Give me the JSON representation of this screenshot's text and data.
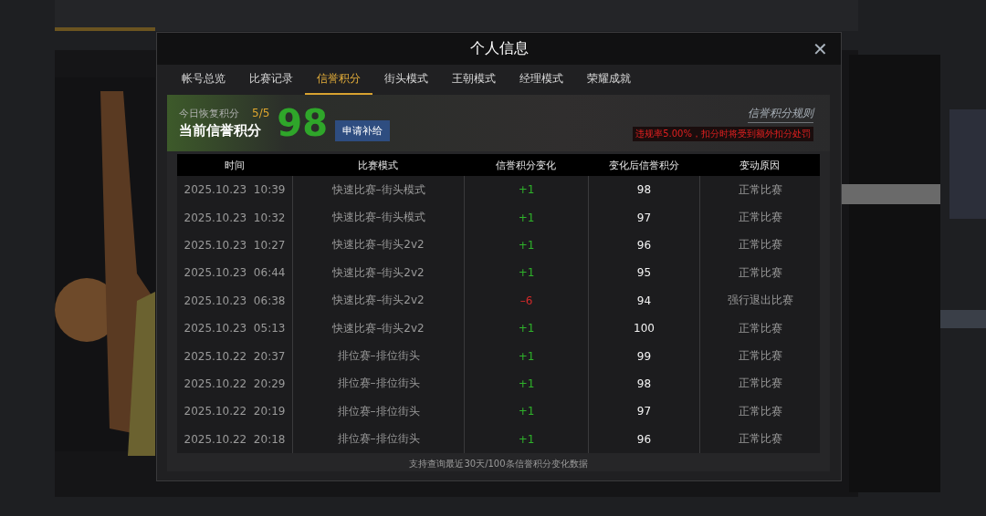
{
  "dialog": {
    "title": "个人信息",
    "close": "✕"
  },
  "tabs": [
    {
      "label": "帐号总览",
      "selected": false
    },
    {
      "label": "比赛记录",
      "selected": false
    },
    {
      "label": "信誉积分",
      "selected": true
    },
    {
      "label": "街头模式",
      "selected": false
    },
    {
      "label": "王朝模式",
      "selected": false
    },
    {
      "label": "经理模式",
      "selected": false
    },
    {
      "label": "荣耀成就",
      "selected": false
    }
  ],
  "summary": {
    "recovery_label": "今日恢复积分",
    "recovery_value": "5/5",
    "current_label": "当前信誉积分",
    "score": "98",
    "apply_button": "申请补给",
    "rules_link": "信誉积分规则",
    "warning": "违规率5.00%，扣分时将受到额外扣分处罚"
  },
  "table": {
    "columns": [
      "时间",
      "比赛模式",
      "信誉积分变化",
      "变化后信誉积分",
      "变动原因"
    ],
    "rows": [
      {
        "time": "2025.10.23  10:39",
        "mode": "快速比赛–街头模式",
        "change": "+1",
        "kind": "gain",
        "after": "98",
        "reason": "正常比赛"
      },
      {
        "time": "2025.10.23  10:32",
        "mode": "快速比赛–街头模式",
        "change": "+1",
        "kind": "gain",
        "after": "97",
        "reason": "正常比赛"
      },
      {
        "time": "2025.10.23  10:27",
        "mode": "快速比赛–街头2v2",
        "change": "+1",
        "kind": "gain",
        "after": "96",
        "reason": "正常比赛"
      },
      {
        "time": "2025.10.23  06:44",
        "mode": "快速比赛–街头2v2",
        "change": "+1",
        "kind": "gain",
        "after": "95",
        "reason": "正常比赛"
      },
      {
        "time": "2025.10.23  06:38",
        "mode": "快速比赛–街头2v2",
        "change": "–6",
        "kind": "loss",
        "after": "94",
        "reason": "强行退出比赛"
      },
      {
        "time": "2025.10.23  05:13",
        "mode": "快速比赛–街头2v2",
        "change": "+1",
        "kind": "gain",
        "after": "100",
        "reason": "正常比赛"
      },
      {
        "time": "2025.10.22  20:37",
        "mode": "排位赛–排位街头",
        "change": "+1",
        "kind": "gain",
        "after": "99",
        "reason": "正常比赛"
      },
      {
        "time": "2025.10.22  20:29",
        "mode": "排位赛–排位街头",
        "change": "+1",
        "kind": "gain",
        "after": "98",
        "reason": "正常比赛"
      },
      {
        "time": "2025.10.22  20:19",
        "mode": "排位赛–排位街头",
        "change": "+1",
        "kind": "gain",
        "after": "97",
        "reason": "正常比赛"
      },
      {
        "time": "2025.10.22  20:18",
        "mode": "排位赛–排位街头",
        "change": "+1",
        "kind": "gain",
        "after": "96",
        "reason": "正常比赛"
      }
    ],
    "footer": "支持查询最近30天/100条信誉积分变化数据"
  }
}
